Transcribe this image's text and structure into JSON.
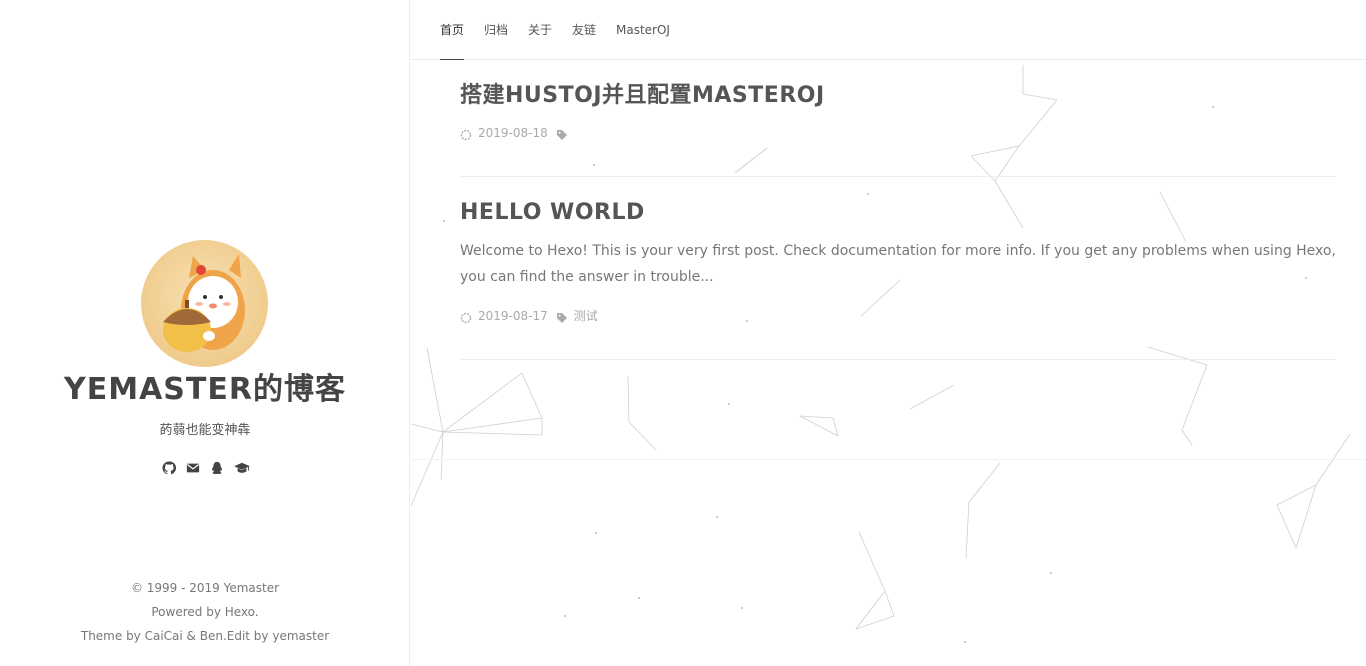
{
  "nav": {
    "items": [
      "首页",
      "归档",
      "关于",
      "友链",
      "MasterOJ"
    ]
  },
  "sidebar": {
    "title": "YEMASTER的博客",
    "subtitle": "菂蒻也能变神犇",
    "social_icons": [
      "github-icon",
      "mail-icon",
      "qq-icon",
      "graduation-cap-icon"
    ],
    "footer": {
      "copyright": "© 1999 - 2019 Yemaster",
      "powered": "Powered by Hexo.",
      "theme": "Theme by CaiCai & Ben.Edit by yemaster"
    }
  },
  "posts": [
    {
      "title": "搭建HUSTOJ并且配置MASTEROJ",
      "date": "2019-08-18",
      "tag": ""
    },
    {
      "title": "HELLO WORLD",
      "excerpt": "Welcome to Hexo! This is your very first post. Check documentation for more info. If you get any problems when using Hexo, you can find the answer in trouble...",
      "date": "2019-08-17",
      "tag": "测试"
    }
  ],
  "colors": {
    "text": "#555555",
    "meta": "#aaaaaa",
    "divider": "#eeeeee",
    "avatar_bg": "#f1cf93"
  }
}
